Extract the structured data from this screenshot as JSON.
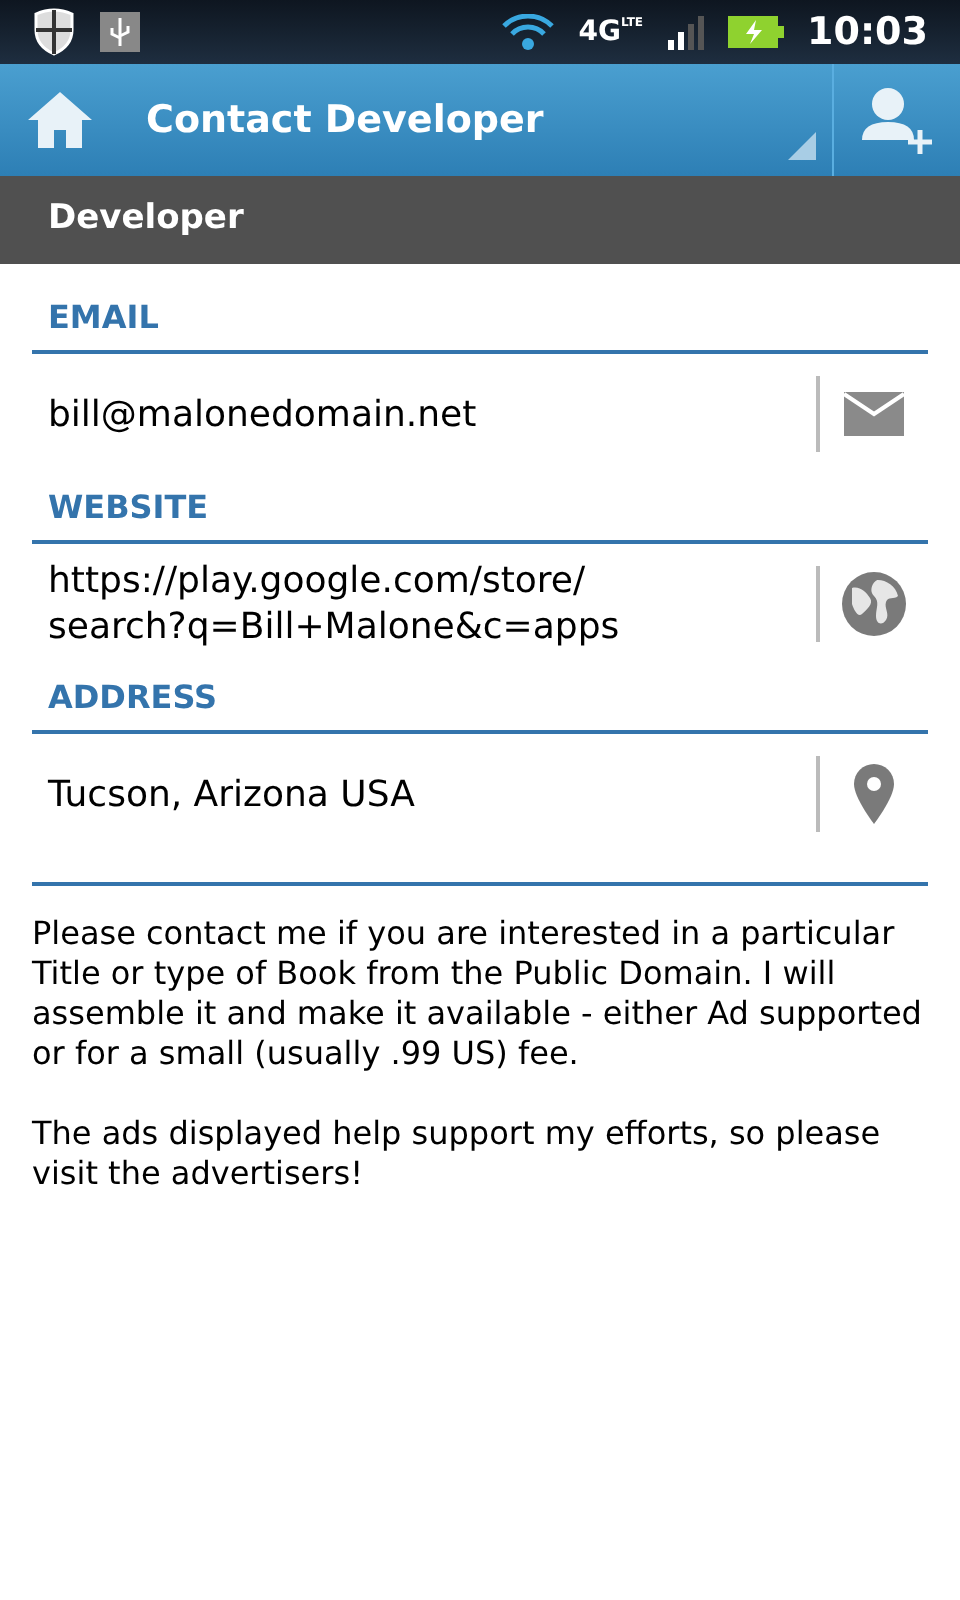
{
  "status_bar": {
    "network": "4G",
    "network_sub": "LTE",
    "time": "10:03"
  },
  "action_bar": {
    "title": "Contact Developer"
  },
  "section": {
    "title": "Developer"
  },
  "fields": [
    {
      "kind": "email",
      "label": "EMAIL",
      "value": "bill@malonedomain.net"
    },
    {
      "kind": "website",
      "label": "WEBSITE",
      "value": "https://play.google.com/store/\nsearch?q=Bill+Malone&c=apps"
    },
    {
      "kind": "address",
      "label": "ADDRESS",
      "value": "Tucson, Arizona USA"
    }
  ],
  "paragraphs": [
    "Please contact me if you are interested in a particular Title or type of Book from the Public Domain. I will assemble it and make it available - either Ad supported or for a small (usually .99 US) fee.",
    "The ads displayed help support my efforts, so please visit the advertisers!"
  ]
}
